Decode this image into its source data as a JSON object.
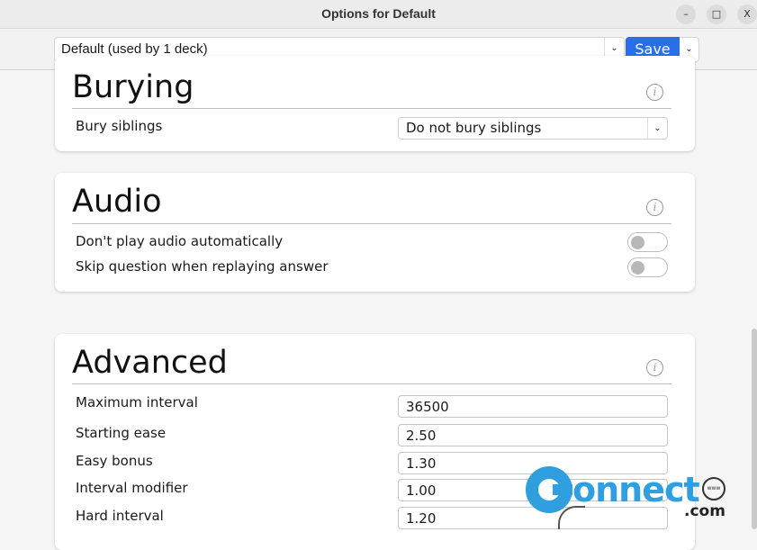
{
  "window": {
    "title": "Options for Default",
    "minimize_glyph": "–",
    "maximize_glyph": "□",
    "close_glyph": "X"
  },
  "toolbar": {
    "preset_value": "Default (used by 1 deck)",
    "save_label": "Save",
    "chevron_glyph": "⌄"
  },
  "sections": {
    "burying": {
      "title": "Burying",
      "info_glyph": "i",
      "bury_siblings": {
        "label": "Bury siblings",
        "value": "Do not bury siblings"
      }
    },
    "audio": {
      "title": "Audio",
      "info_glyph": "i",
      "dont_play": {
        "label": "Don't play audio automatically",
        "on": false
      },
      "skip_question": {
        "label": "Skip question when replaying answer",
        "on": false
      }
    },
    "advanced": {
      "title": "Advanced",
      "info_glyph": "i",
      "fields": [
        {
          "label": "Maximum interval",
          "value": "36500"
        },
        {
          "label": "Starting ease",
          "value": "2.50"
        },
        {
          "label": "Easy bonus",
          "value": "1.30"
        },
        {
          "label": "Interval modifier",
          "value": "1.00"
        },
        {
          "label": "Hard interval",
          "value": "1.20"
        }
      ]
    }
  },
  "watermark": {
    "text": "onnect",
    "suffix": ".com",
    "globe_text": "www"
  }
}
